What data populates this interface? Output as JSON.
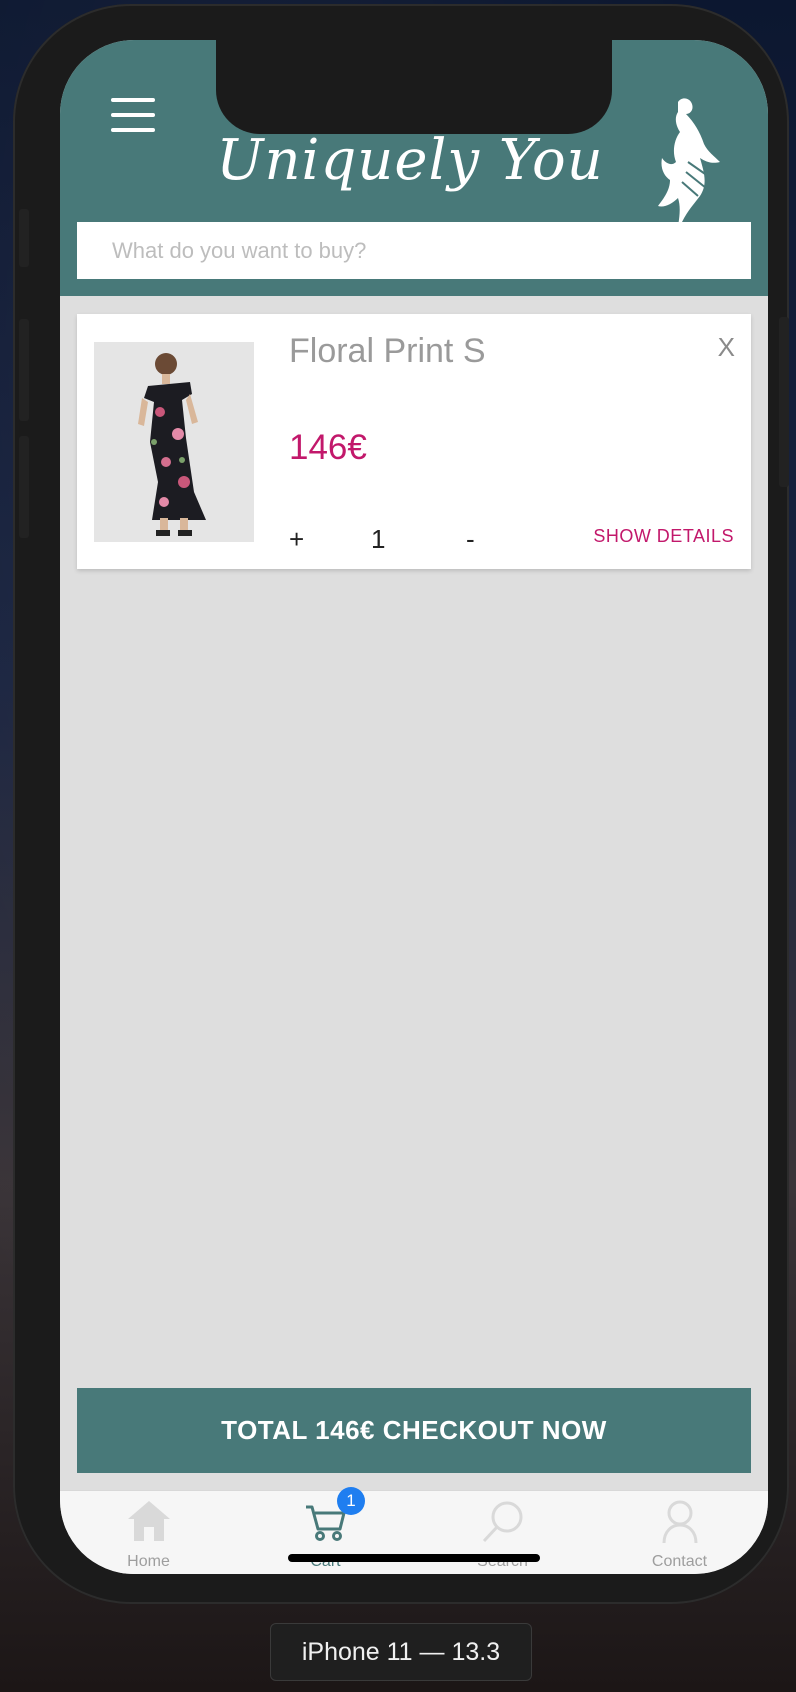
{
  "app": {
    "brand_title": "Uniquely You",
    "search_placeholder": "What do you want to buy?"
  },
  "cart": {
    "items": [
      {
        "name": "Floral Print S",
        "price": "146€",
        "quantity": "1",
        "plus_label": "+",
        "minus_label": "-",
        "remove_label": "X",
        "details_label": "SHOW DETAILS"
      }
    ],
    "checkout_label": "TOTAL 146€ CHECKOUT NOW"
  },
  "tabbar": {
    "tabs": [
      {
        "label": "Home",
        "icon": "home-icon"
      },
      {
        "label": "Cart",
        "icon": "cart-icon",
        "badge": "1",
        "active": true
      },
      {
        "label": "Search",
        "icon": "search-icon"
      },
      {
        "label": "Contact",
        "icon": "person-icon"
      }
    ]
  },
  "device": {
    "label": "iPhone 11 — 13.3"
  },
  "colors": {
    "brand": "#487979",
    "accent": "#c2186b",
    "badge": "#1f7ef0"
  }
}
